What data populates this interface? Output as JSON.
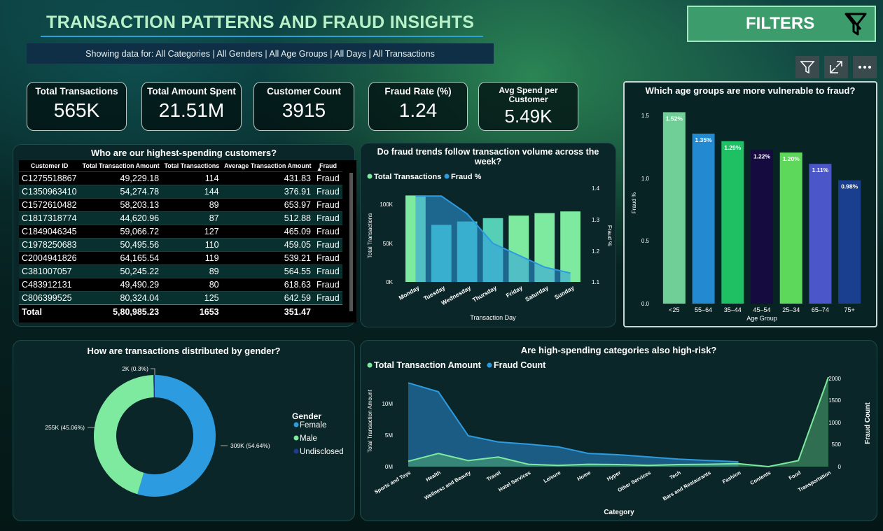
{
  "header": {
    "title": "TRANSACTION PATTERNS AND FRAUD INSIGHTS",
    "subtitle": "Showing data for: All Categories | All Genders | All Age Groups | All Days | All Transactions",
    "filters_label": "FILTERS"
  },
  "toolbar": {
    "icons": [
      "filter-icon",
      "focus-mode-icon",
      "more-options-icon"
    ]
  },
  "kpis": [
    {
      "label": "Total Transactions",
      "value": "565K"
    },
    {
      "label": "Total Amount Spent",
      "value": "21.51M"
    },
    {
      "label": "Customer Count",
      "value": "3915"
    },
    {
      "label": "Fraud Rate (%)",
      "value": "1.24"
    },
    {
      "label": "Avg Spend per Customer",
      "value": "5.49K"
    }
  ],
  "customers_table": {
    "title": "Who are our highest-spending customers?",
    "columns": [
      "Customer ID",
      "Total Transaction Amount",
      "Total Transactions",
      "Average Transaction Amount",
      "Fraud"
    ],
    "rows": [
      [
        "C1275518867",
        "49,229.18",
        "114",
        "431.83",
        "Fraud"
      ],
      [
        "C1350963410",
        "54,274.78",
        "144",
        "376.91",
        "Fraud"
      ],
      [
        "C1572610482",
        "58,203.13",
        "89",
        "653.97",
        "Fraud"
      ],
      [
        "C1817318774",
        "44,620.96",
        "87",
        "512.88",
        "Fraud"
      ],
      [
        "C1849046345",
        "59,066.72",
        "127",
        "465.09",
        "Fraud"
      ],
      [
        "C1978250683",
        "50,495.56",
        "110",
        "459.05",
        "Fraud"
      ],
      [
        "C2004941826",
        "64,165.54",
        "119",
        "539.21",
        "Fraud"
      ],
      [
        "C381007057",
        "50,245.22",
        "89",
        "564.55",
        "Fraud"
      ],
      [
        "C483912131",
        "49,490.29",
        "80",
        "618.63",
        "Fraud"
      ],
      [
        "C806399525",
        "80,324.04",
        "125",
        "642.59",
        "Fraud"
      ]
    ],
    "total": [
      "Total",
      "5,80,985.23",
      "1653",
      "351.47",
      ""
    ]
  },
  "weekday_chart": {
    "title": "Do fraud trends follow transaction volume across the week?",
    "legend": [
      "Total Transactions",
      "Fraud %"
    ],
    "xlabel": "Transaction Day",
    "ylabel": "Total Transactions",
    "y2label": "Fraud %",
    "yticks": [
      "100K",
      "50K",
      "0K"
    ],
    "y2ticks": [
      "1.4",
      "1.3",
      "1.2",
      "1.1"
    ]
  },
  "age_chart": {
    "title": "Which age groups are more vulnerable to fraud?",
    "xlabel": "Age Group",
    "ylabel": "Fraud %",
    "yticks": [
      "1.5",
      "1.0",
      "0.5",
      "0.0"
    ]
  },
  "gender_chart": {
    "title": "How are transactions distributed by gender?",
    "legend_title": "Gender",
    "labels": [
      "309K (54.64%)",
      "255K (45.06%)",
      "2K (0.3%)"
    ]
  },
  "category_chart": {
    "title": "Are high-spending categories also high-risk?",
    "legend": [
      "Total Transaction Amount",
      "Fraud Count"
    ],
    "xlabel": "Category",
    "ylabel": "Total Transaction Amount",
    "y2label": "Fraud Count",
    "yticks": [
      "10M",
      "5M",
      "0M"
    ],
    "y2ticks": [
      "2000",
      "1500",
      "1000",
      "500",
      "0"
    ]
  },
  "colors": {
    "green": "#7deaa0",
    "blue": "#2d9be0",
    "teal": "#45c7bb",
    "navy": "#1d3b8f"
  },
  "chart_data": [
    {
      "type": "bar",
      "title": "Do fraud trends follow transaction volume across the week?",
      "categories": [
        "Monday",
        "Tuesday",
        "Wednesday",
        "Thursday",
        "Friday",
        "Saturday",
        "Sunday"
      ],
      "series": [
        {
          "name": "Total Transactions",
          "values": [
            103000,
            68000,
            72000,
            76000,
            79000,
            82000,
            84000
          ]
        },
        {
          "name": "Fraud %",
          "values": [
            1.37,
            1.37,
            1.31,
            1.21,
            1.17,
            1.13,
            1.11
          ]
        }
      ],
      "xlabel": "Transaction Day",
      "ylabel": "Total Transactions",
      "y2label": "Fraud %",
      "ylim": [
        0,
        120000
      ],
      "y2lim": [
        1.08,
        1.42
      ]
    },
    {
      "type": "bar",
      "title": "Which age groups are more vulnerable to fraud?",
      "categories": [
        "<25",
        "55–64",
        "35–44",
        "45–54",
        "25–34",
        "65–74",
        "75+"
      ],
      "values": [
        1.52,
        1.35,
        1.29,
        1.22,
        1.2,
        1.11,
        0.98
      ],
      "data_labels": [
        "1.52%",
        "1.35%",
        "1.29%",
        "1.22%",
        "1.20%",
        "1.11%",
        "0.98%"
      ],
      "xlabel": "Age Group",
      "ylabel": "Fraud %",
      "ylim": [
        0,
        1.6
      ]
    },
    {
      "type": "pie",
      "title": "How are transactions distributed by gender?",
      "categories": [
        "Female",
        "Male",
        "Undisclosed"
      ],
      "values": [
        309,
        255,
        2
      ],
      "percent": [
        54.64,
        45.06,
        0.3
      ]
    },
    {
      "type": "area",
      "title": "Are high-spending categories also high-risk?",
      "categories": [
        "Sports and Toys",
        "Health",
        "Wellness and Beauty",
        "Travel",
        "Hotel Services",
        "Leisure",
        "Home",
        "Hyper",
        "Other Services",
        "Tech",
        "Bars and Restaurants",
        "Fashion",
        "Contents",
        "Food",
        "Transportation"
      ],
      "series": [
        {
          "name": "Total Transaction Amount",
          "values": [
            0.9,
            2.2,
            1.0,
            1.6,
            0.4,
            0.2,
            0.4,
            0.35,
            0.2,
            0.35,
            0.4,
            0.5,
            0.0,
            1.0,
            16.3
          ]
        },
        {
          "name": "Fraud Count",
          "values": [
            1900,
            1700,
            700,
            560,
            510,
            450,
            300,
            270,
            220,
            170,
            140,
            110,
            null,
            null,
            null
          ]
        }
      ],
      "xlabel": "Category",
      "ylabel": "Total Transaction Amount",
      "y2label": "Fraud Count",
      "ylim": [
        0,
        14
      ],
      "y2lim": [
        0,
        2000
      ]
    }
  ]
}
